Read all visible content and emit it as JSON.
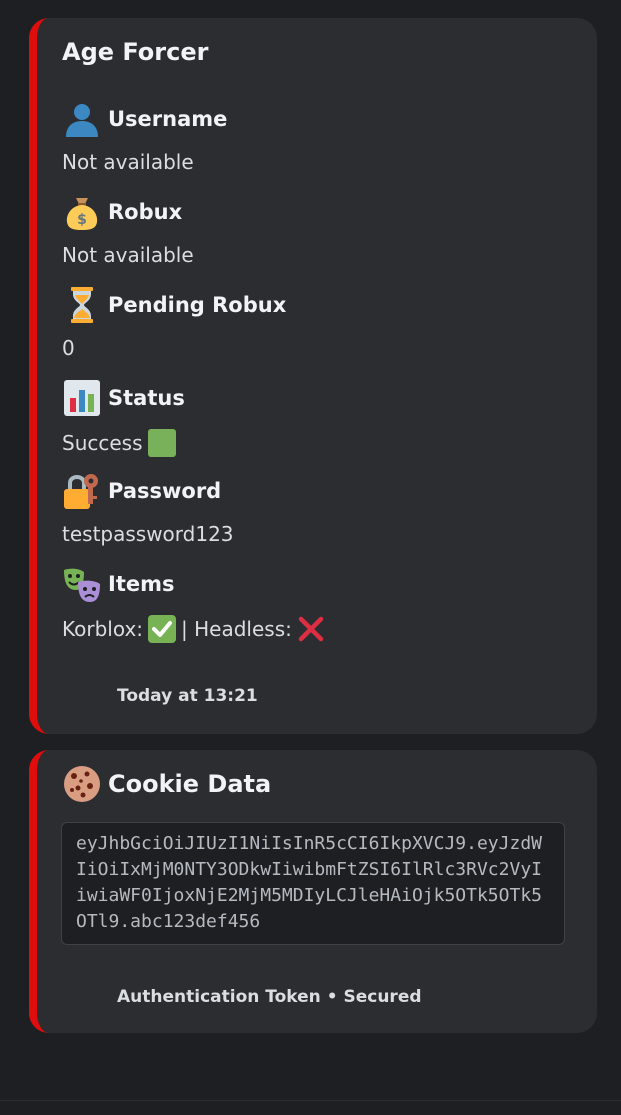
{
  "embeds": [
    {
      "title": "Age Forcer",
      "fields": [
        {
          "icon": "bust-in-silhouette-icon",
          "name": "Username",
          "value": "Not available"
        },
        {
          "icon": "money-bag-icon",
          "name": "Robux",
          "value": "Not available"
        },
        {
          "icon": "hourglass-icon",
          "name": "Pending Robux",
          "value": "0"
        },
        {
          "icon": "bar-chart-icon",
          "name": "Status",
          "value": "Success",
          "value_emoji": "green-square-icon"
        },
        {
          "icon": "lock-with-key-icon",
          "name": "Password",
          "value": "testpassword123"
        },
        {
          "icon": "performing-arts-icon",
          "name": "Items",
          "value_parts": [
            "Korblox:",
            "| Headless:"
          ],
          "value_emojis": [
            "check-mark-button-icon",
            "cross-mark-icon"
          ]
        }
      ],
      "footer": "Today at 13:21",
      "accent_color": "#e00d0d"
    },
    {
      "title": "Cookie Data",
      "title_icon": "cookie-icon",
      "code": "eyJhbGciOiJIUzI1NiIsInR5cCI6IkpXVCJ9.eyJzdWIiOiIxMjM0NTY3ODkwIiwibmFtZSI6IlRlc3RVc2VyIiwiaWF0IjoxNjE2MjM5MDIyLCJleHAiOjk5OTk5OTk5OTl9.abc123def456",
      "footer": "Authentication Token • Secured",
      "accent_color": "#e00d0d"
    }
  ]
}
